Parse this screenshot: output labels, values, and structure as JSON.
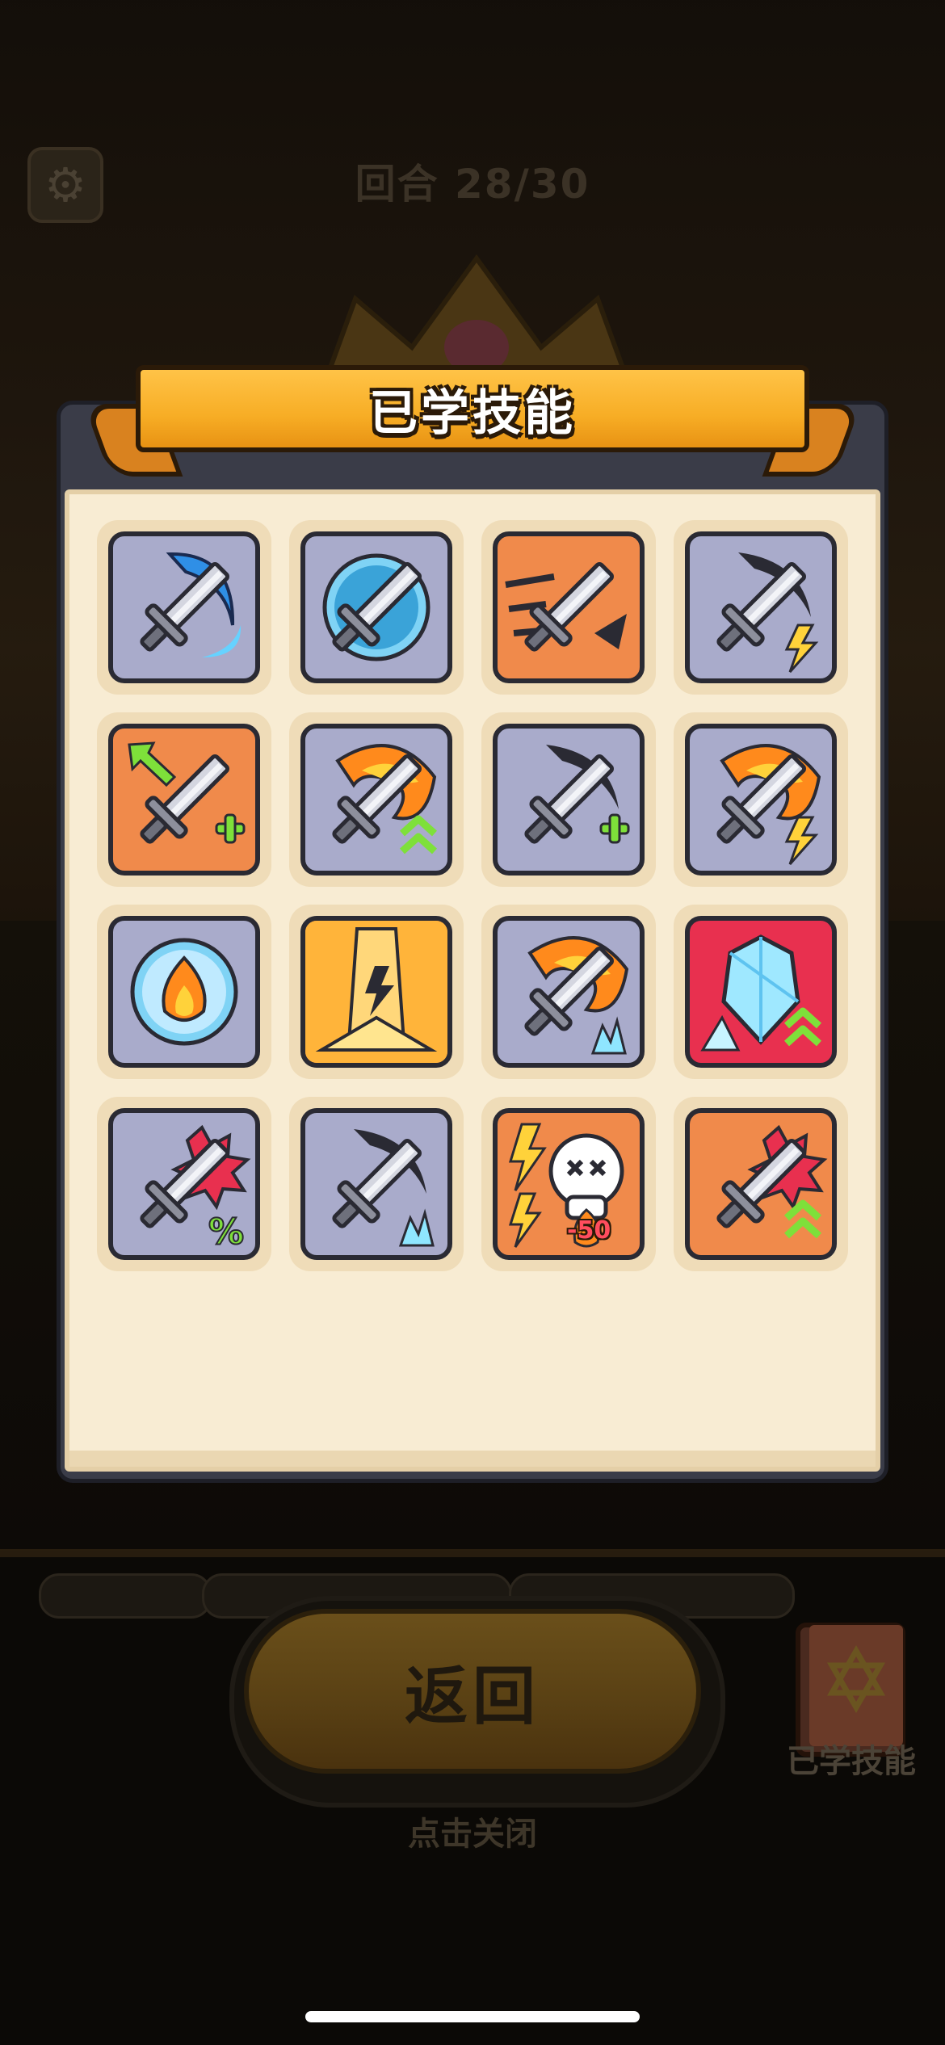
{
  "header": {
    "round_text": "回合 28/30"
  },
  "modal": {
    "title": "已学技能"
  },
  "skills": [
    {
      "icon": "sword-blue-slash-icon",
      "bg": "#a9abcb"
    },
    {
      "icon": "sword-bubble-shield-icon",
      "bg": "#a9abcb"
    },
    {
      "icon": "sword-dash-icon",
      "bg": "#f08a4b"
    },
    {
      "icon": "sword-dark-slash-lightning-icon",
      "bg": "#a9abcb"
    },
    {
      "icon": "sword-green-arrows-plus-icon",
      "bg": "#f08a4b"
    },
    {
      "icon": "sword-fire-upgrade-icon",
      "bg": "#a9abcb"
    },
    {
      "icon": "sword-dark-slash-plus-icon",
      "bg": "#a9abcb"
    },
    {
      "icon": "sword-fire-lightning-icon",
      "bg": "#a9abcb"
    },
    {
      "icon": "fire-bubble-icon",
      "bg": "#a9abcb"
    },
    {
      "icon": "lightning-pillar-icon",
      "bg": "#f08a4b"
    },
    {
      "icon": "sword-fire-ice-icon",
      "bg": "#a9abcb"
    },
    {
      "icon": "ice-crystal-upgrade-icon",
      "bg": "#e8304f"
    },
    {
      "icon": "sword-burst-percent-icon",
      "bg": "#a9abcb"
    },
    {
      "icon": "sword-dark-slash-ice-icon",
      "bg": "#a9abcb"
    },
    {
      "icon": "skull-lightning-fire-icon",
      "bg": "#f08a4b",
      "badge": "-50"
    },
    {
      "icon": "sword-burst-upgrade-icon",
      "bg": "#f08a4b"
    }
  ],
  "bottom": {
    "return_label": "返回",
    "tap_close": "点击关闭",
    "skillbook_label": "已学技能"
  }
}
